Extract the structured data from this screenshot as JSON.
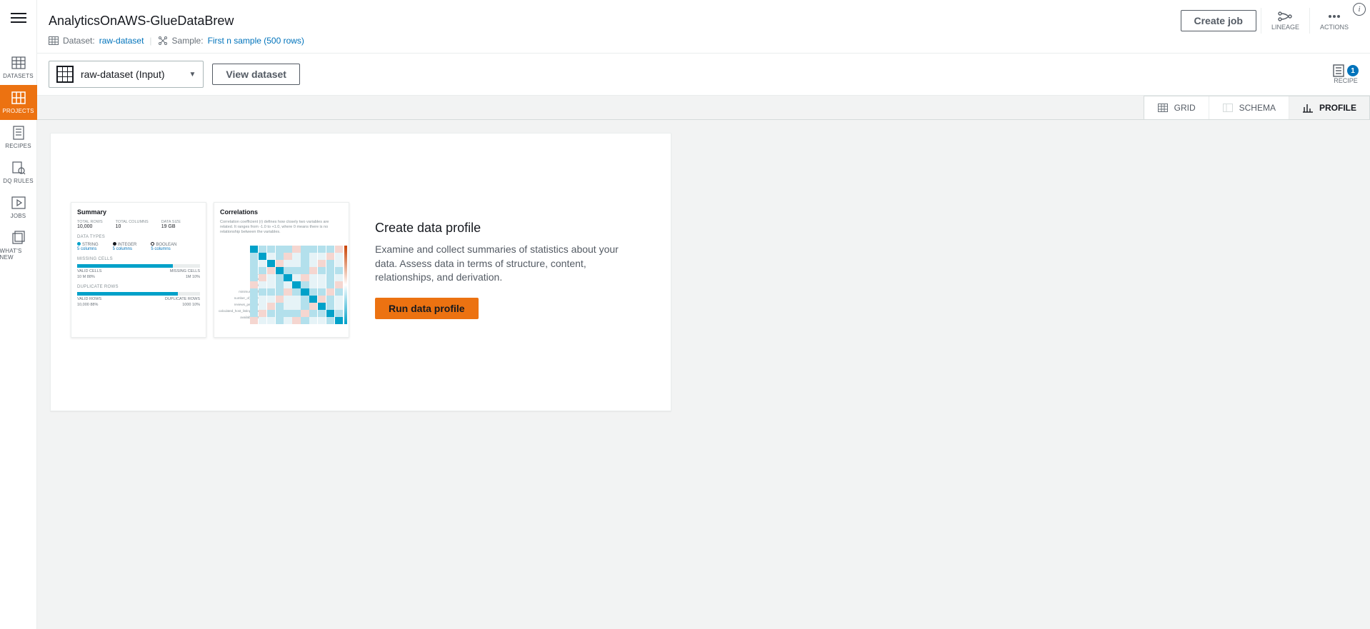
{
  "sidebar": {
    "items": [
      {
        "label": "DATASETS"
      },
      {
        "label": "PROJECTS"
      },
      {
        "label": "RECIPES"
      },
      {
        "label": "DQ RULES"
      },
      {
        "label": "JOBS"
      },
      {
        "label": "WHAT'S NEW"
      }
    ]
  },
  "header": {
    "title": "AnalyticsOnAWS-GlueDataBrew",
    "dataset_label": "Dataset:",
    "dataset_link": "raw-dataset",
    "sample_label": "Sample:",
    "sample_link": "First n sample (500 rows)",
    "create_job": "Create job",
    "lineage": "LINEAGE",
    "actions": "ACTIONS"
  },
  "toolbar": {
    "dataset_selected": "raw-dataset (Input)",
    "view_dataset": "View dataset",
    "recipe_label": "RECIPE",
    "recipe_count": "1"
  },
  "tabs": {
    "grid": "GRID",
    "schema": "SCHEMA",
    "profile": "PROFILE"
  },
  "profile": {
    "heading": "Create data profile",
    "body": "Examine and collect summaries of statistics about your data. Assess data in terms of structure, content, relationships, and derivation.",
    "run": "Run data profile"
  },
  "thumb1": {
    "title": "Summary",
    "total_rows_lbl": "TOTAL ROWS",
    "total_rows": "10,000",
    "total_cols_lbl": "TOTAL COLUMNS",
    "total_cols": "10",
    "data_size_lbl": "DATA SIZE",
    "data_size": "19 GB",
    "data_types_lbl": "DATA TYPES",
    "type_string": "STRING",
    "type_integer": "INTEGER",
    "type_boolean": "BOOLEAN",
    "five_cols": "5 columns",
    "missing_lbl": "MISSING CELLS",
    "valid_cells": "VALID CELLS",
    "valid_val": "10 M",
    "valid_pct": "88%",
    "missing_cells": "MISSING CELLS",
    "missing_val": "1M",
    "missing_pct": "10%",
    "dup_lbl": "DUPLICATE ROWS",
    "valid_rows": "VALID ROWS",
    "valid_rows_val": "10,000",
    "valid_rows_pct": "88%",
    "dup_rows": "DUPLICATE ROWS",
    "dup_val": "1000",
    "dup_pct": "10%"
  },
  "thumb2": {
    "title": "Correlations",
    "desc": "Correlation coefficient (r) defines how closely two variables are related. It ranges from -1.0 to +1.0, where 0 means there is no relationship between the variables."
  }
}
